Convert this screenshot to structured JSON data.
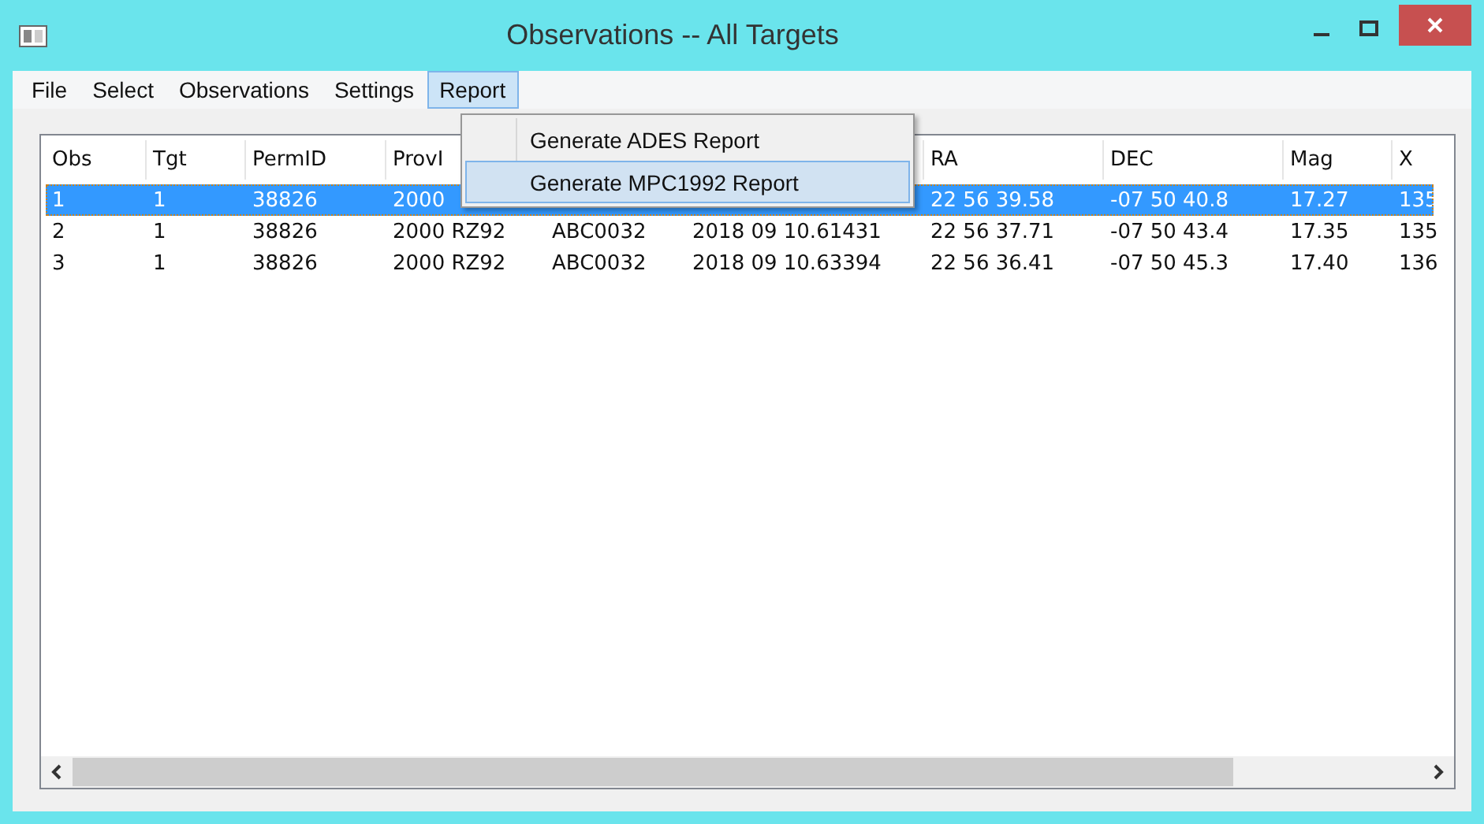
{
  "window": {
    "title": "Observations -- All Targets"
  },
  "menu": [
    {
      "label": "File",
      "selected": false
    },
    {
      "label": "Select",
      "selected": false
    },
    {
      "label": "Observations",
      "selected": false
    },
    {
      "label": "Settings",
      "selected": false
    },
    {
      "label": "Report",
      "selected": true
    }
  ],
  "dropdown": [
    {
      "label": "Generate ADES Report",
      "selected": false
    },
    {
      "label": "Generate MPC1992 Report",
      "selected": true
    }
  ],
  "table": {
    "columns": [
      {
        "label": "Obs"
      },
      {
        "label": "Tgt"
      },
      {
        "label": "PermID"
      },
      {
        "label": "ProvI"
      },
      {},
      {},
      {
        "label": "RA"
      },
      {
        "label": "DEC"
      },
      {
        "label": "Mag"
      },
      {
        "label": "X"
      }
    ],
    "rows": [
      {
        "selected": true,
        "cells": [
          "1",
          "1",
          "38826",
          "2000",
          "",
          "",
          "22 56 39.58",
          "-07 50 40.8",
          "17.27",
          "135"
        ]
      },
      {
        "selected": false,
        "cells": [
          "2",
          "1",
          "38826",
          "2000 RZ92",
          "ABC0032",
          "2018 09 10.61431",
          "22 56 37.71",
          "-07 50 43.4",
          "17.35",
          "135"
        ]
      },
      {
        "selected": false,
        "cells": [
          "3",
          "1",
          "38826",
          "2000 RZ92",
          "ABC0032",
          "2018 09 10.63394",
          "22 56 36.41",
          "-07 50 45.3",
          "17.40",
          "136"
        ]
      }
    ]
  }
}
